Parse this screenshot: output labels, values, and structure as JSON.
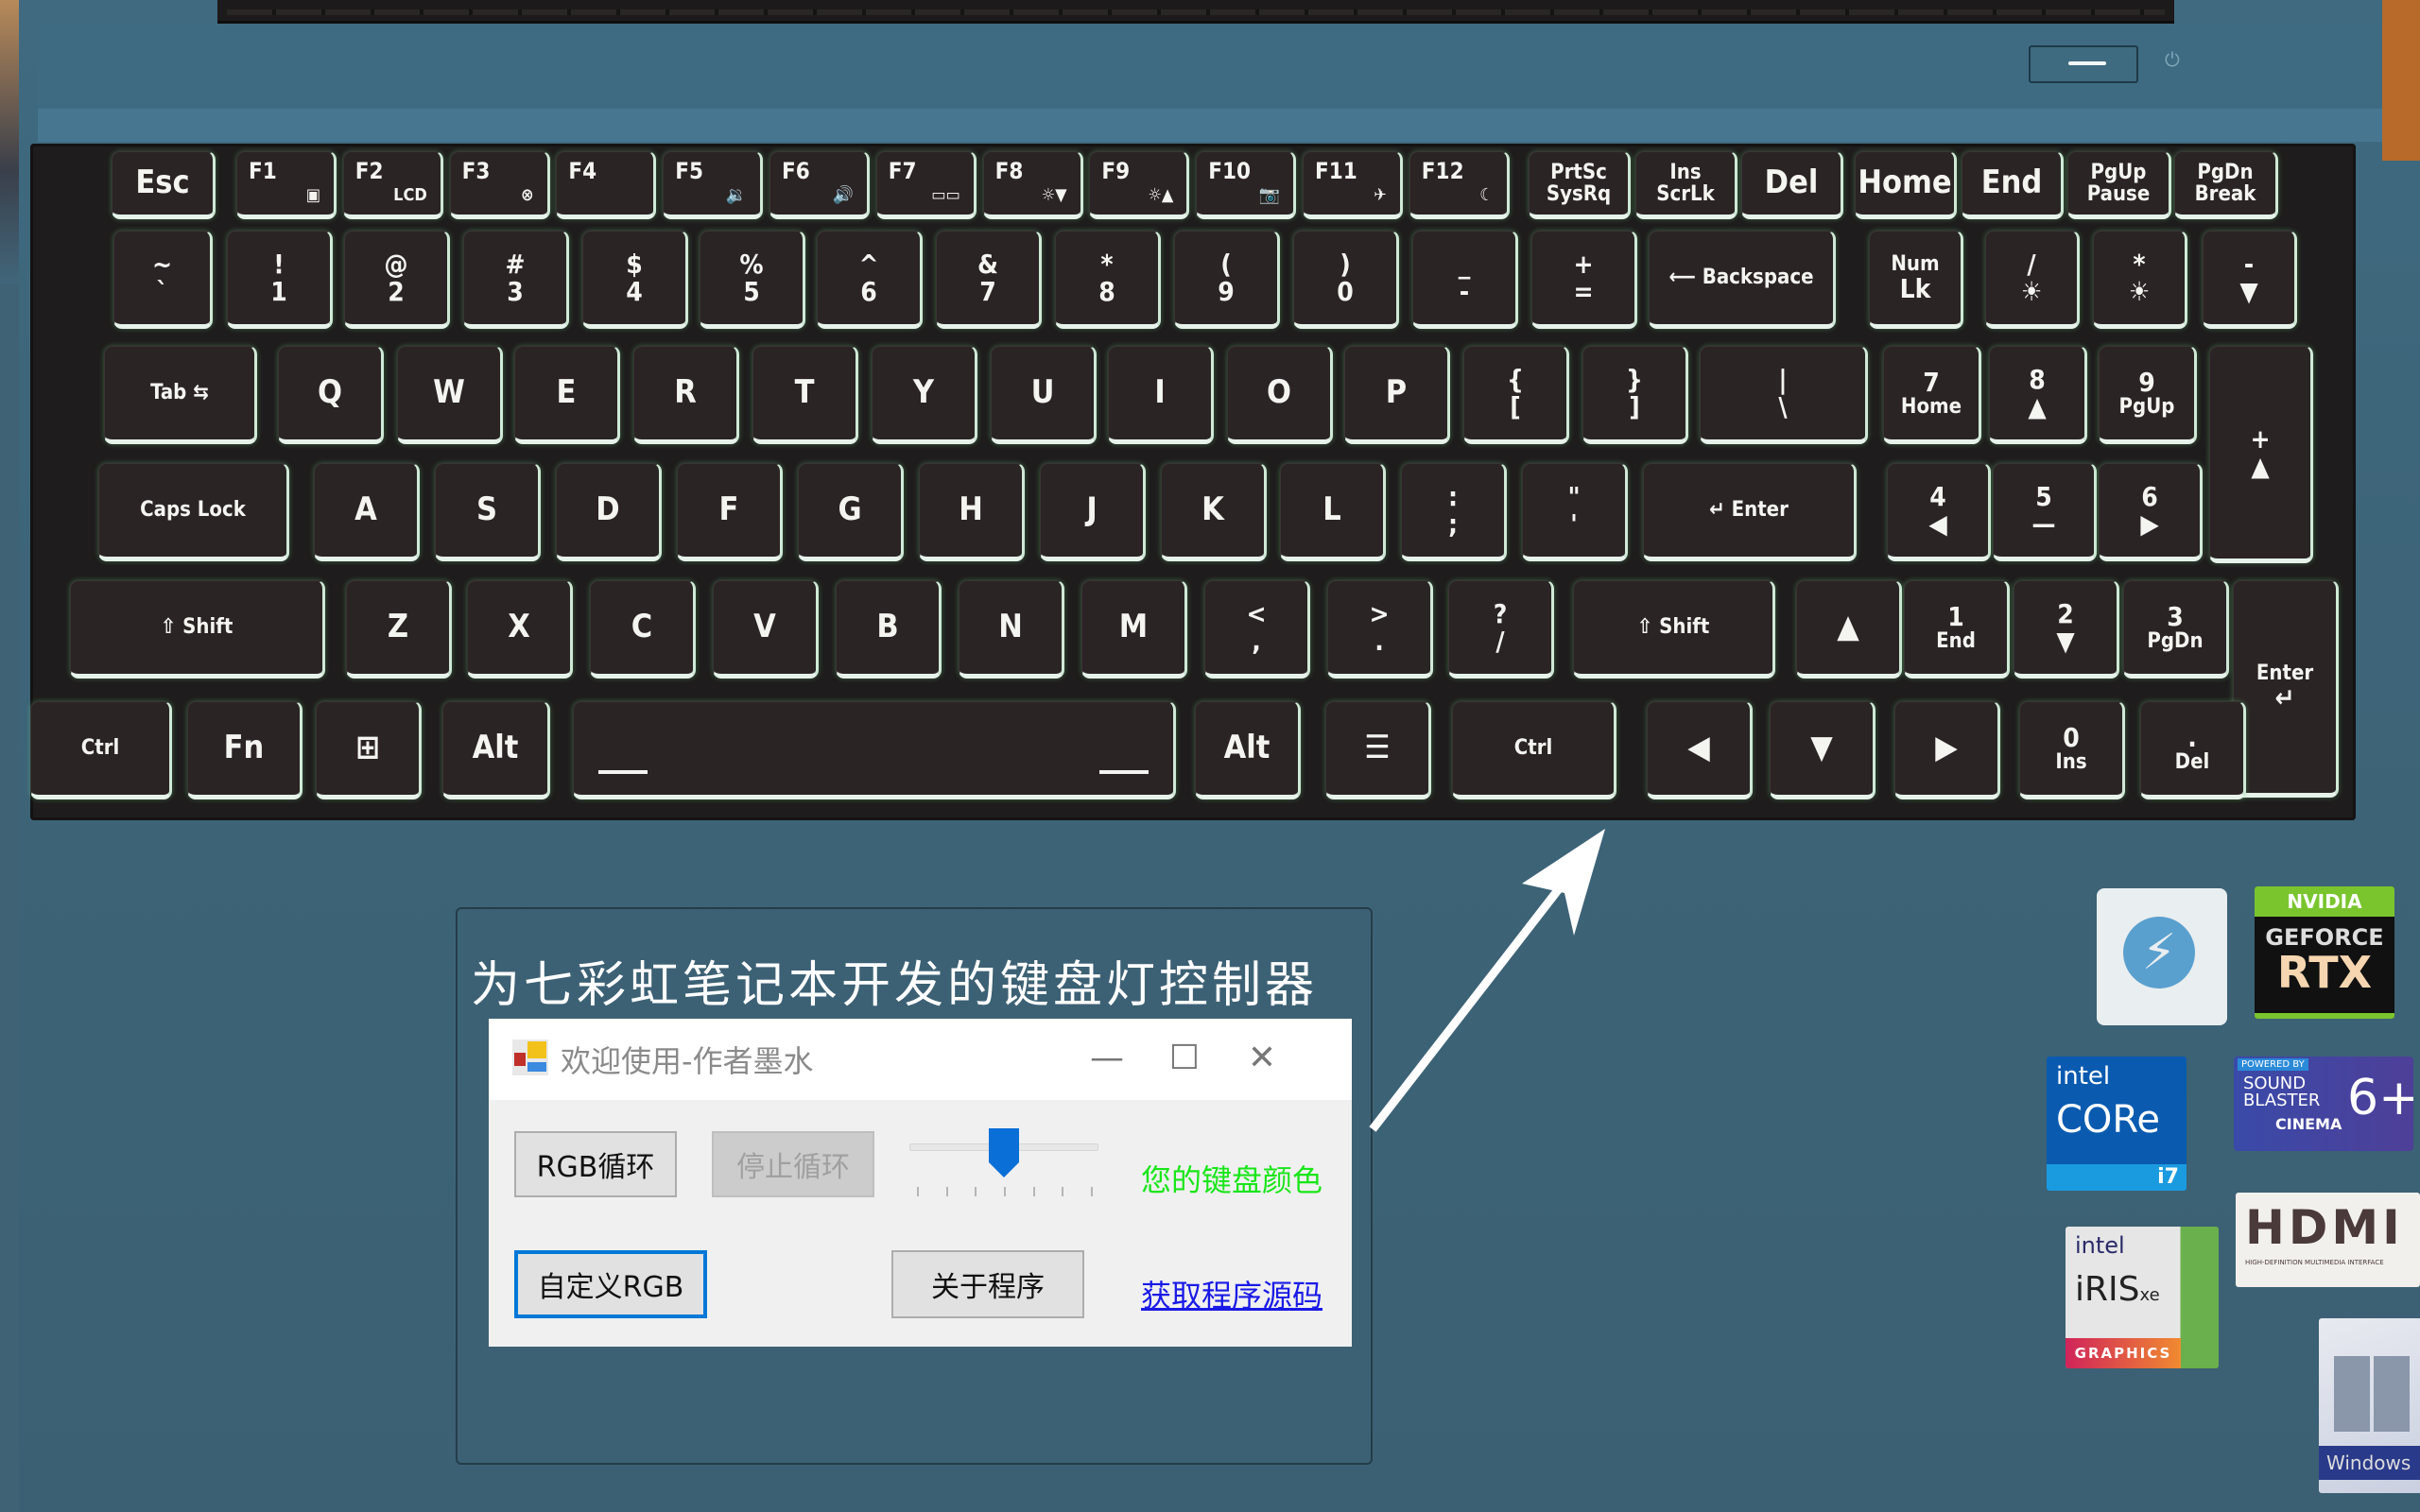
{
  "scene": "laptop keyboard photo with overlaid Windows app screenshot",
  "caption": "为七彩虹笔记本开发的键盘灯控制器",
  "window": {
    "title": "欢迎使用-作者墨水",
    "icon": "app-icon",
    "controls": {
      "minimize": "—",
      "maximize": "☐",
      "close": "✕"
    },
    "buttons": {
      "rgb_cycle": "RGB循环",
      "stop_cycle": "停止循环",
      "custom_rgb": "自定义RGB",
      "about": "关于程序"
    },
    "stop_cycle_enabled": false,
    "focused_button": "custom_rgb",
    "slider": {
      "min": 0,
      "max": 6,
      "value": 3,
      "ticks": 7
    },
    "color_label": "您的键盘颜色",
    "color_label_color": "#19e619",
    "source_link": "获取程序源码",
    "link_color": "#1a1ae6"
  },
  "keyboard": {
    "backlight_color": "#7fe08a",
    "rows": [
      [
        {
          "m": "Esc"
        },
        {
          "m": "F1",
          "s": "▣"
        },
        {
          "m": "F2",
          "s": "LCD"
        },
        {
          "m": "F3",
          "s": "⊗"
        },
        {
          "m": "F4"
        },
        {
          "m": "F5",
          "s": "🔉"
        },
        {
          "m": "F6",
          "s": "🔊"
        },
        {
          "m": "F7",
          "s": "▭▭"
        },
        {
          "m": "F8",
          "s": "☼▼"
        },
        {
          "m": "F9",
          "s": "☼▲"
        },
        {
          "m": "F10",
          "s": "📷"
        },
        {
          "m": "F11",
          "s": "✈"
        },
        {
          "m": "F12",
          "s": "☾"
        },
        {
          "t": "PrtSc",
          "b": "SysRq"
        },
        {
          "t": "Ins",
          "b": "ScrLk"
        },
        {
          "m": "Del"
        },
        {
          "m": "Home"
        },
        {
          "m": "End"
        },
        {
          "t": "PgUp",
          "b": "Pause"
        },
        {
          "t": "PgDn",
          "b": "Break"
        }
      ],
      [
        {
          "t": "~",
          "b": "`"
        },
        {
          "t": "!",
          "b": "1"
        },
        {
          "t": "@",
          "b": "2"
        },
        {
          "t": "#",
          "b": "3"
        },
        {
          "t": "$",
          "b": "4"
        },
        {
          "t": "%",
          "b": "5"
        },
        {
          "t": "^",
          "b": "6"
        },
        {
          "t": "&",
          "b": "7"
        },
        {
          "t": "*",
          "b": "8"
        },
        {
          "t": "(",
          "b": "9"
        },
        {
          "t": ")",
          "b": "0"
        },
        {
          "t": "_",
          "b": "-"
        },
        {
          "t": "+",
          "b": "="
        },
        {
          "m": "⟵ Backspace"
        },
        {
          "t": "Num",
          "b": "Lk"
        },
        {
          "t": "/",
          "b": "☀"
        },
        {
          "t": "*",
          "b": "☀"
        },
        {
          "t": "-",
          "b": "▼"
        }
      ],
      [
        {
          "m": "Tab ⇆"
        },
        {
          "m": "Q"
        },
        {
          "m": "W"
        },
        {
          "m": "E"
        },
        {
          "m": "R"
        },
        {
          "m": "T"
        },
        {
          "m": "Y"
        },
        {
          "m": "U"
        },
        {
          "m": "I"
        },
        {
          "m": "O"
        },
        {
          "m": "P"
        },
        {
          "t": "{",
          "b": "["
        },
        {
          "t": "}",
          "b": "]"
        },
        {
          "t": "|",
          "b": "\\"
        },
        {
          "t": "7",
          "b": "Home"
        },
        {
          "t": "8",
          "b": "▲"
        },
        {
          "t": "9",
          "b": "PgUp"
        },
        {
          "t": "+",
          "b": "▲"
        }
      ],
      [
        {
          "m": "Caps Lock"
        },
        {
          "m": "A"
        },
        {
          "m": "S"
        },
        {
          "m": "D"
        },
        {
          "m": "F"
        },
        {
          "m": "G"
        },
        {
          "m": "H"
        },
        {
          "m": "J"
        },
        {
          "m": "K"
        },
        {
          "m": "L"
        },
        {
          "t": ":",
          "b": ";"
        },
        {
          "t": "\"",
          "b": "'"
        },
        {
          "m": "↵ Enter"
        },
        {
          "t": "4",
          "b": "◀"
        },
        {
          "t": "5",
          "b": "—"
        },
        {
          "t": "6",
          "b": "▶"
        }
      ],
      [
        {
          "m": "⇧ Shift"
        },
        {
          "m": "Z"
        },
        {
          "m": "X"
        },
        {
          "m": "C"
        },
        {
          "m": "V"
        },
        {
          "m": "B"
        },
        {
          "m": "N"
        },
        {
          "m": "M"
        },
        {
          "t": "<",
          "b": ","
        },
        {
          "t": ">",
          "b": "."
        },
        {
          "t": "?",
          "b": "/"
        },
        {
          "m": "⇧ Shift"
        },
        {
          "m": "▲"
        },
        {
          "t": "1",
          "b": "End"
        },
        {
          "t": "2",
          "b": "▼"
        },
        {
          "t": "3",
          "b": "PgDn"
        },
        {
          "t": "Enter",
          "b": "↵"
        }
      ],
      [
        {
          "m": "Ctrl"
        },
        {
          "m": "Fn"
        },
        {
          "m": "⊞"
        },
        {
          "m": "Alt"
        },
        {
          "m": ""
        },
        {
          "m": "Alt"
        },
        {
          "m": "☰"
        },
        {
          "m": "Ctrl"
        },
        {
          "m": "◀"
        },
        {
          "m": "▼"
        },
        {
          "m": "▶"
        },
        {
          "t": "0",
          "b": "Ins"
        },
        {
          "t": ".",
          "b": "Del"
        }
      ]
    ]
  },
  "stickers": [
    {
      "name": "thunderbolt",
      "text": "⚡"
    },
    {
      "name": "nvidia-geforce-rtx",
      "brand": "NVIDIA",
      "line1": "GEFORCE",
      "line2": "RTX"
    },
    {
      "name": "intel-core-i7",
      "brand": "intel",
      "line1": "CORe",
      "line2": "i7"
    },
    {
      "name": "sound-blaster",
      "small": "POWERED BY",
      "line1": "SOUND",
      "line2": "BLASTER",
      "line3": "CINEMA",
      "mark": "6+"
    },
    {
      "name": "intel-iris-xe",
      "brand": "intel",
      "line1": "iRIS",
      "sup": "xe",
      "line2": "GRAPHICS"
    },
    {
      "name": "hdmi",
      "line1": "HDMI",
      "line2": "HIGH-DEFINITION MULTIMEDIA INTERFACE"
    },
    {
      "name": "windows",
      "line1": "Windows"
    }
  ]
}
